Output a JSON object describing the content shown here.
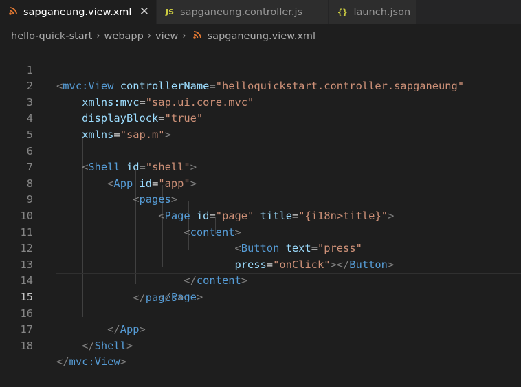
{
  "tabs": [
    {
      "label": "sapganeung.view.xml",
      "icon": "rss-icon",
      "active": true,
      "close": "✕"
    },
    {
      "label": "sapganeung.controller.js",
      "icon": "JS",
      "active": false
    },
    {
      "label": "launch.json",
      "icon": "{}",
      "active": false
    }
  ],
  "breadcrumb": {
    "items": [
      "hello-quick-start",
      "webapp",
      "view",
      "sapganeung.view.xml"
    ],
    "separator": "›"
  },
  "editor": {
    "current_line": 15,
    "lines": [
      {
        "n": "1"
      },
      {
        "n": "2"
      },
      {
        "n": "3"
      },
      {
        "n": "4"
      },
      {
        "n": "5"
      },
      {
        "n": "6"
      },
      {
        "n": "7"
      },
      {
        "n": "8"
      },
      {
        "n": "9"
      },
      {
        "n": "10"
      },
      {
        "n": "11"
      },
      {
        "n": "12"
      },
      {
        "n": "13"
      },
      {
        "n": "14"
      },
      {
        "n": "15"
      },
      {
        "n": "16"
      },
      {
        "n": "17"
      },
      {
        "n": "18"
      }
    ],
    "tokens": {
      "l1_tag": "mvc:View",
      "l1_attr": "controllerName",
      "l1_val": "\"helloquickstart.controller.sapganeung\"",
      "l2_attr": "xmlns:mvc",
      "l2_val": "\"sap.ui.core.mvc\"",
      "l3_attr": "displayBlock",
      "l3_val": "\"true\"",
      "l4_attr": "xmlns",
      "l4_val": "\"sap.m\"",
      "l6_tag": "Shell",
      "l6_attr": "id",
      "l6_val": "\"shell\"",
      "l7_tag": "App",
      "l7_attr": "id",
      "l7_val": "\"app\"",
      "l8_tag": "pages",
      "l9_tag": "Page",
      "l9_attr1": "id",
      "l9_val1": "\"page\"",
      "l9_attr2": "title",
      "l9_val2": "\"{i18n>title}\"",
      "l10_tag": "content",
      "l11_tag": "Button",
      "l11_attr": "text",
      "l11_val": "\"press\"",
      "l12_attr": "press",
      "l12_val": "\"onClick\"",
      "l12_tag": "Button",
      "l13_tag": "content",
      "l14_tag": "Page",
      "l15_tag": "pages",
      "l16_tag": "App",
      "l17_tag": "Shell",
      "l18_tag": "mvc:View"
    }
  },
  "colors": {
    "background": "#1e1e1e",
    "tag": "#569cd6",
    "attribute": "#9cdcfe",
    "string": "#ce9178",
    "punctuation": "#808080"
  }
}
